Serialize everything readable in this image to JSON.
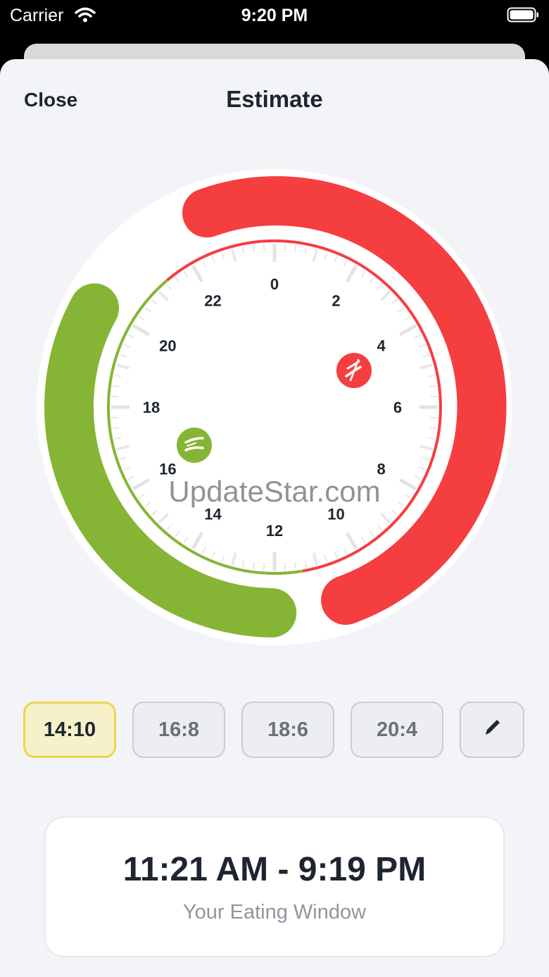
{
  "status_bar": {
    "carrier": "Carrier",
    "time": "9:20 PM"
  },
  "header": {
    "close_label": "Close",
    "title": "Estimate"
  },
  "dial": {
    "hour_labels": [
      "0",
      "2",
      "4",
      "6",
      "8",
      "10",
      "12",
      "14",
      "16",
      "18",
      "20",
      "22"
    ],
    "eating_start_hour": 11.35,
    "eating_end_hour": 21.32,
    "colors": {
      "eating": "#86b535",
      "fasting": "#f53e40"
    },
    "eating_icon": "fork-knife-icon",
    "fasting_icon": "no-eating-icon"
  },
  "presets": {
    "items": [
      {
        "label": "14:10",
        "selected": true
      },
      {
        "label": "16:8",
        "selected": false
      },
      {
        "label": "18:6",
        "selected": false
      },
      {
        "label": "20:4",
        "selected": false
      }
    ],
    "edit_icon": "pencil-icon"
  },
  "eating_window": {
    "range": "11:21 AM - 9:19 PM",
    "label": "Your Eating Window"
  },
  "watermark": "UpdateStar.com"
}
